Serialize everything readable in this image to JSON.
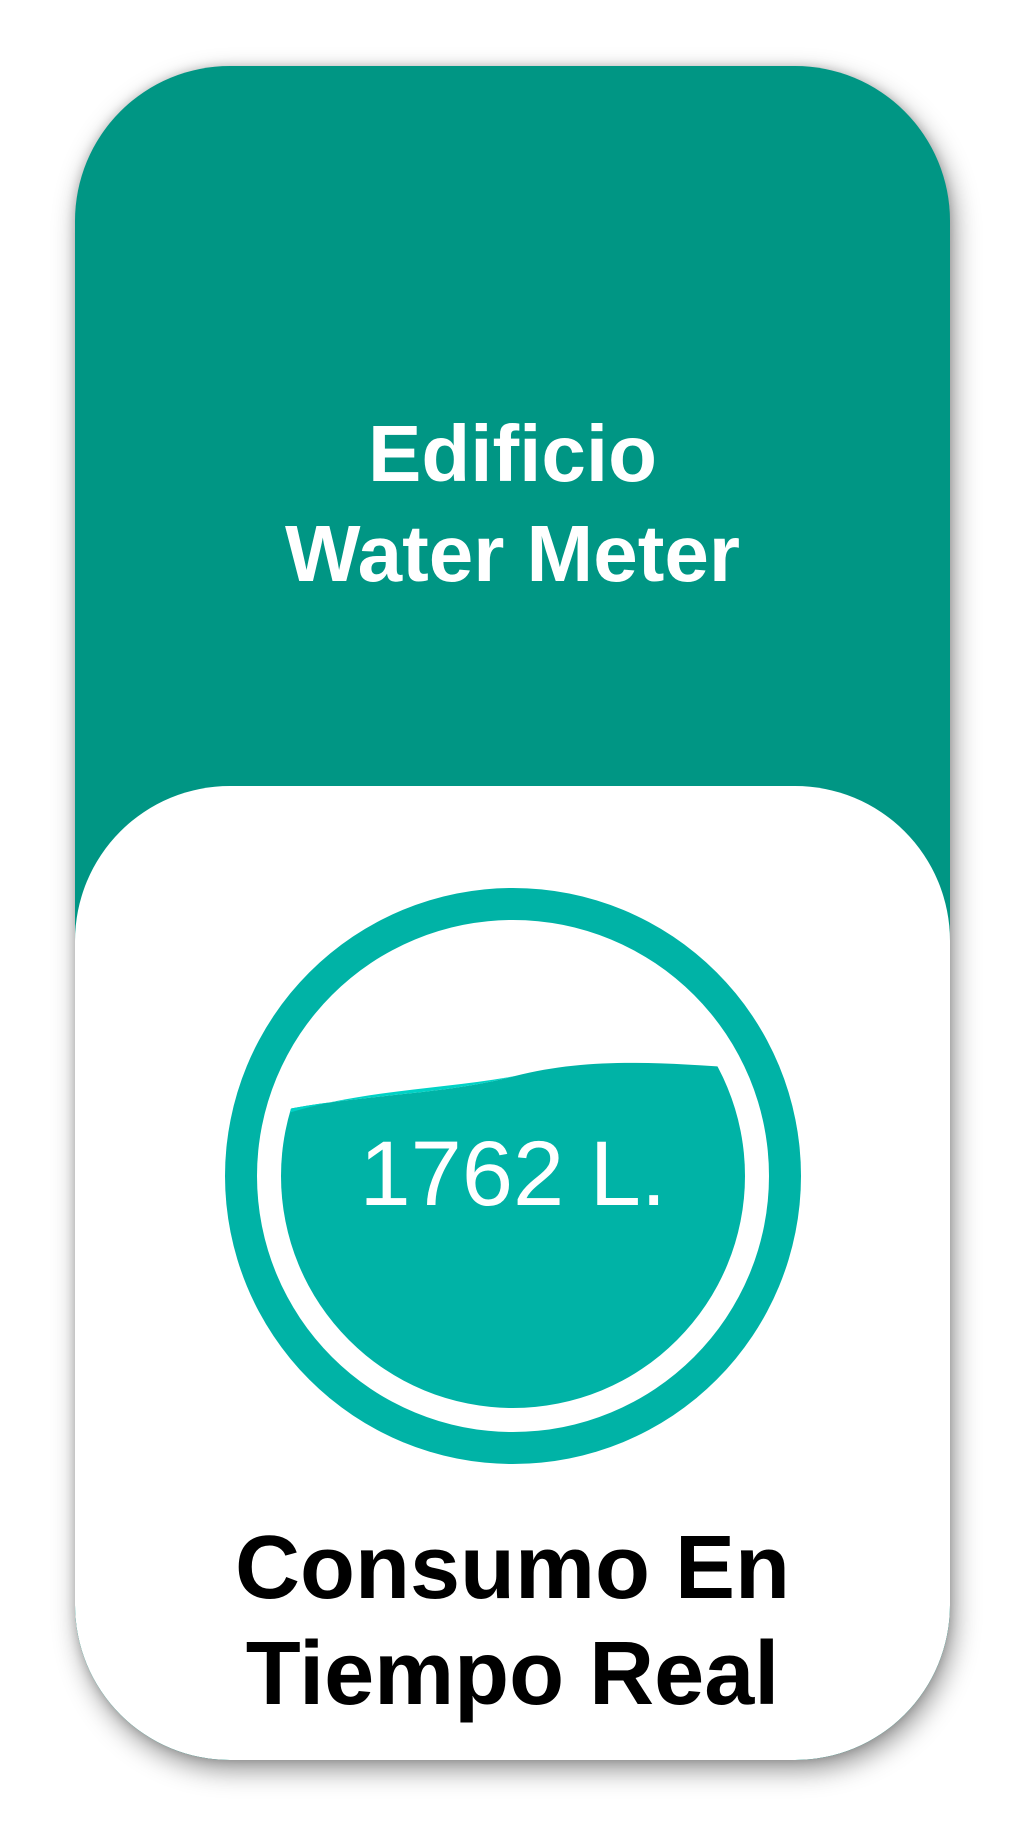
{
  "header": {
    "line1": "Edificio",
    "line2": "Water Meter"
  },
  "meter": {
    "reading": "1762 L.",
    "fill_fraction": 0.7,
    "icon": "water-level-gauge-icon"
  },
  "footer": {
    "line1": "Consumo En",
    "line2": "Tiempo Real"
  },
  "colors": {
    "brand_dark": "#009684",
    "water": "#00B3A6",
    "water_highlight": "#00D2C6",
    "panel": "#FFFFFF",
    "text_dark": "#000000",
    "text_light": "#FFFFFF"
  }
}
